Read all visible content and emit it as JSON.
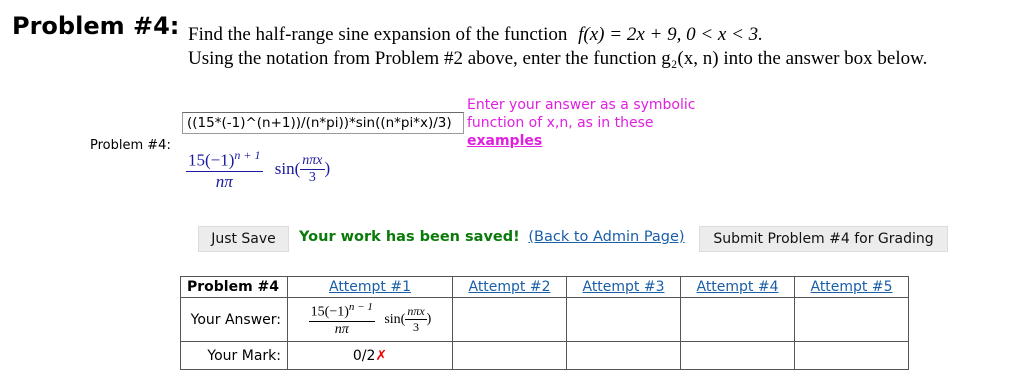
{
  "problem": {
    "heading": "Problem #4:",
    "statement_line1_prefix": "Find the half-range sine expansion of the function",
    "statement_fx": "f(x) = 2x + 9,  0 < x < 3.",
    "statement_line2": "Using the notation from Problem #2 above, enter the function g₂(x, n) into the answer box below."
  },
  "answer": {
    "side_label": "Problem #4:",
    "input_value": "((15*(-1)^(n+1))/(n*pi))*sin((n*pi*x)/3)",
    "hint_line1": "Enter your answer as a symbolic",
    "hint_line2": "function of x,n, as in these",
    "hint_link": "examples",
    "preview": {
      "numerator": "15(−1)",
      "exponent": "n + 1",
      "denominator": "nπ",
      "sin": "sin(",
      "arg_num": "nπx",
      "arg_den": "3",
      "close": ")"
    }
  },
  "actions": {
    "just_save": "Just Save",
    "saved_msg": "Your work has been saved!",
    "back_link": "(Back to Admin Page)",
    "submit": "Submit Problem #4 for Grading"
  },
  "attempts": {
    "row_label": "Problem #4",
    "answer_label": "Your Answer:",
    "mark_label": "Your Mark:",
    "columns": [
      "Attempt #1",
      "Attempt #2",
      "Attempt #3",
      "Attempt #4",
      "Attempt #5"
    ],
    "attempt1_answer": {
      "numerator": "15(−1)",
      "exponent": "n − 1",
      "denominator": "nπ",
      "sin": "sin(",
      "arg_num": "nπx",
      "arg_den": "3",
      "close": ")"
    },
    "attempt1_mark": "0/2",
    "attempt1_mark_icon": "✗"
  }
}
